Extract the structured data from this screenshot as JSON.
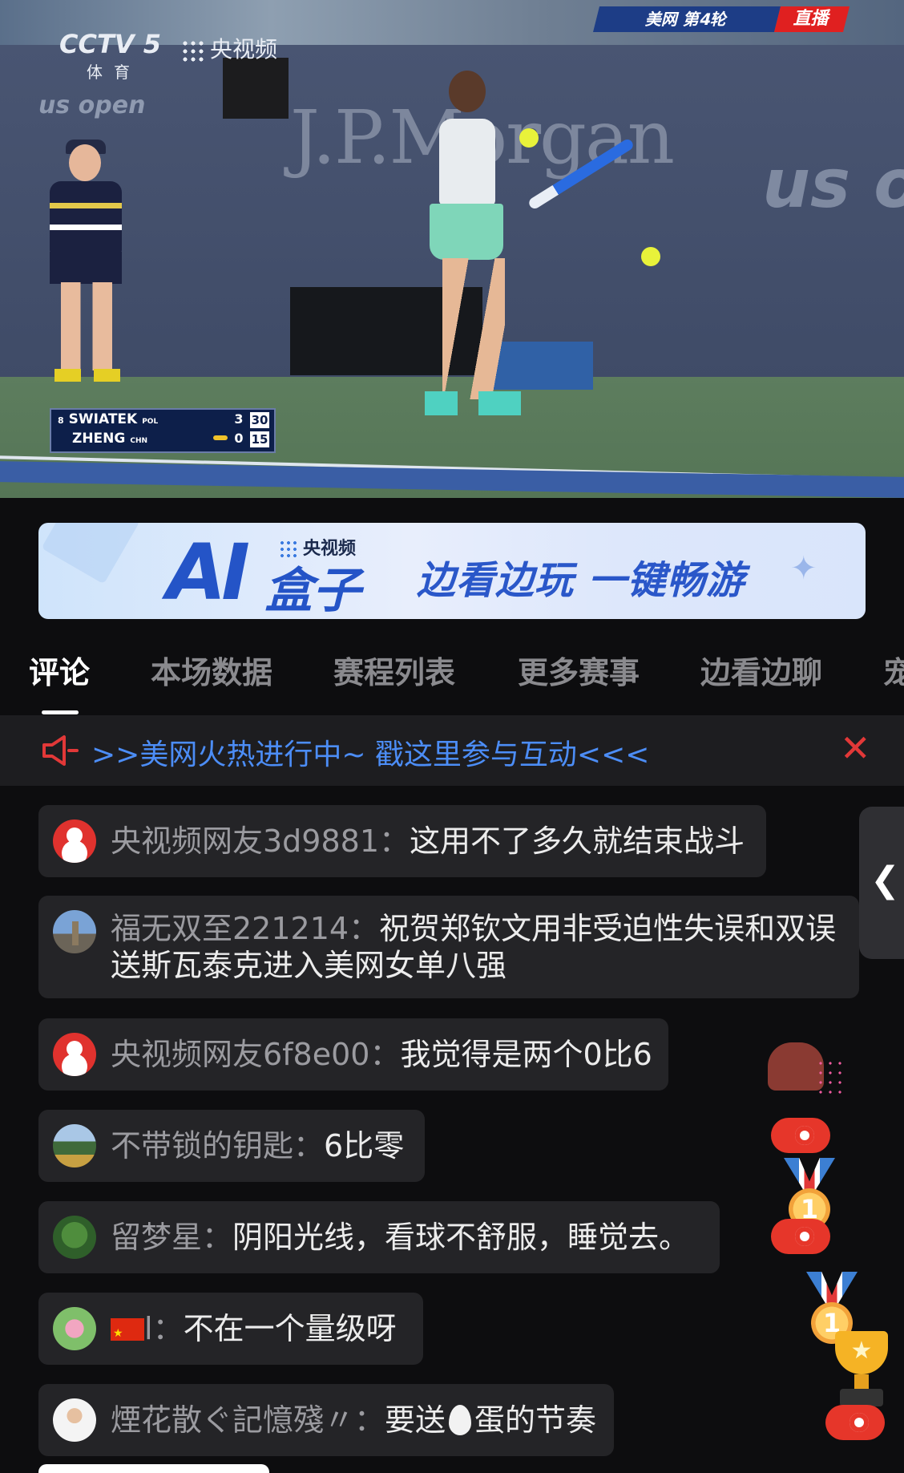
{
  "video": {
    "channel_logo": "CCTV 5",
    "channel_sub": "体育",
    "platform": "央视频",
    "round_tag": "美网  第4轮",
    "live_tag": "直播",
    "sponsor_wall": "J.P.Morgan",
    "usopen_small": "us open",
    "usopen_wall": "us o",
    "scoreboard": {
      "players": [
        {
          "seed": "8",
          "name": "SWIATEK",
          "country": "POL",
          "sets": "3",
          "points": "30"
        },
        {
          "seed": "",
          "name": "ZHENG",
          "country": "CHN",
          "sets": "0",
          "points": "15"
        }
      ]
    }
  },
  "banner": {
    "ai": "AI",
    "box": "盒子",
    "brand": "央视频",
    "slogan": "边看边玩 一键畅游"
  },
  "tabs": [
    {
      "label": "评论",
      "active": true
    },
    {
      "label": "本场数据"
    },
    {
      "label": "赛程列表"
    },
    {
      "label": "更多赛事"
    },
    {
      "label": "边看边聊"
    },
    {
      "label": "宠"
    }
  ],
  "notice": {
    "text": ">>美网火热进行中~ 戳这里参与互动<<<",
    "close_icon": "close-icon",
    "speaker_icon": "speaker-icon"
  },
  "comments": [
    {
      "user": "央视频网友3d9881",
      "text": "这用不了多久就结束战斗",
      "avatar": "cctv-avatar"
    },
    {
      "user": "福无双至221214",
      "text": "祝贺郑钦文用非受迫性失误和双误",
      "text2": "送斯瓦泰克进入美网女单八强",
      "avatar": "tower-avatar"
    },
    {
      "user": "央视频网友6f8e00",
      "text": "我觉得是两个0比6",
      "avatar": "cctv-avatar"
    },
    {
      "user": "不带锁的钥匙",
      "text": "6比零",
      "avatar": "field-avatar"
    },
    {
      "user": "留梦星",
      "text": "阴阳光线，看球不舒服，睡觉去。",
      "avatar": "tree-avatar"
    },
    {
      "user": "l",
      "text": "不在一个量级呀",
      "avatar": "flower-avatar",
      "flag": "china-flag-icon"
    },
    {
      "user": "煙花散ぐ記憶殘〃",
      "text_before": "要送",
      "text_after": "蛋的节奏",
      "avatar": "person-avatar",
      "emoji": "egg-icon"
    }
  ],
  "separator": "：",
  "side_handle": {
    "label": "❮"
  },
  "medal_number": "1",
  "trophy_star": "★"
}
